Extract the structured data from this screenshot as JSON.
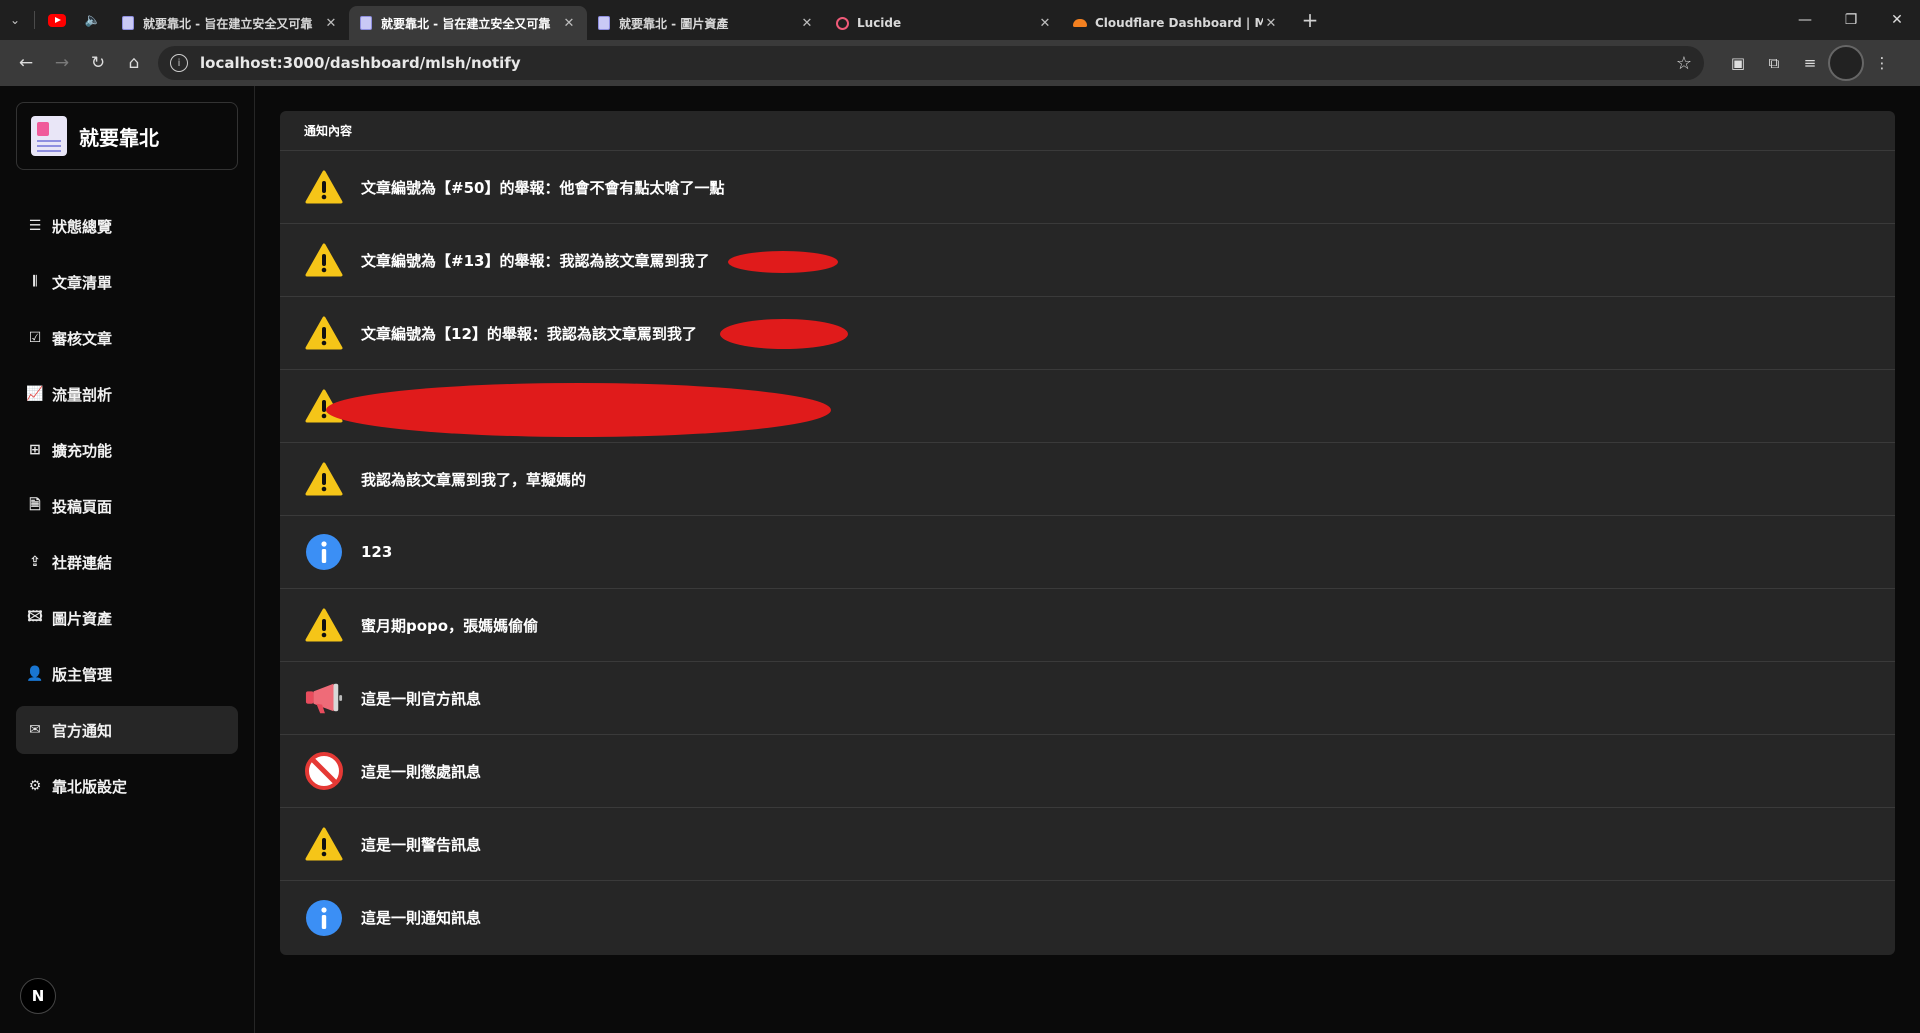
{
  "browser": {
    "tabs": [
      {
        "title": "就要靠北 - 旨在建立安全又可靠",
        "favicon": "doc-icon",
        "active": false
      },
      {
        "title": "就要靠北 - 旨在建立安全又可靠",
        "favicon": "doc-icon",
        "active": true
      },
      {
        "title": "就要靠北 - 圖片資產",
        "favicon": "doc-icon",
        "active": false
      },
      {
        "title": "Lucide",
        "favicon": "lucide-icon",
        "active": false
      },
      {
        "title": "Cloudflare Dashboard | Ma",
        "favicon": "cloudflare-icon",
        "active": false
      }
    ],
    "url": "localhost:3000/dashboard/mlsh/notify"
  },
  "sidebar": {
    "brand": "就要靠北",
    "items": [
      {
        "label": "狀態總覽",
        "icon": "list-icon",
        "active": false
      },
      {
        "label": "文章清單",
        "icon": "library-icon",
        "active": false
      },
      {
        "label": "審核文章",
        "icon": "check-square-icon",
        "active": false
      },
      {
        "label": "流量剖析",
        "icon": "chart-icon",
        "active": false
      },
      {
        "label": "擴充功能",
        "icon": "blocks-icon",
        "active": false
      },
      {
        "label": "投稿頁面",
        "icon": "file-icon",
        "active": false
      },
      {
        "label": "社群連結",
        "icon": "share-icon",
        "active": false
      },
      {
        "label": "圖片資產",
        "icon": "image-icon",
        "active": false
      },
      {
        "label": "版主管理",
        "icon": "user-icon",
        "active": false
      },
      {
        "label": "官方通知",
        "icon": "mail-icon",
        "active": true
      },
      {
        "label": "靠北版設定",
        "icon": "gear-icon",
        "active": false
      }
    ],
    "footer_logo": "N"
  },
  "notifications": {
    "header": "通知內容",
    "rows": [
      {
        "type": "warning",
        "text": "文章編號為【#50】的舉報：他會不會有點太嗆了一點"
      },
      {
        "type": "warning",
        "text": "文章編號為【#13】的舉報：我認為該文章罵到我了"
      },
      {
        "type": "warning",
        "text": "文章編號為【12】的舉報：我認為該文章罵到我了"
      },
      {
        "type": "warning",
        "text": ""
      },
      {
        "type": "warning",
        "text": "我認為該文章罵到我了，草擬媽的"
      },
      {
        "type": "info",
        "text": "123"
      },
      {
        "type": "warning",
        "text": "蜜月期popo，張媽媽偷偷"
      },
      {
        "type": "announcement",
        "text": "這是一則官方訊息"
      },
      {
        "type": "prohibited",
        "text": "這是一則懲處訊息"
      },
      {
        "type": "warning",
        "text": "這是一則警告訊息"
      },
      {
        "type": "info",
        "text": "這是一則通知訊息"
      }
    ]
  }
}
